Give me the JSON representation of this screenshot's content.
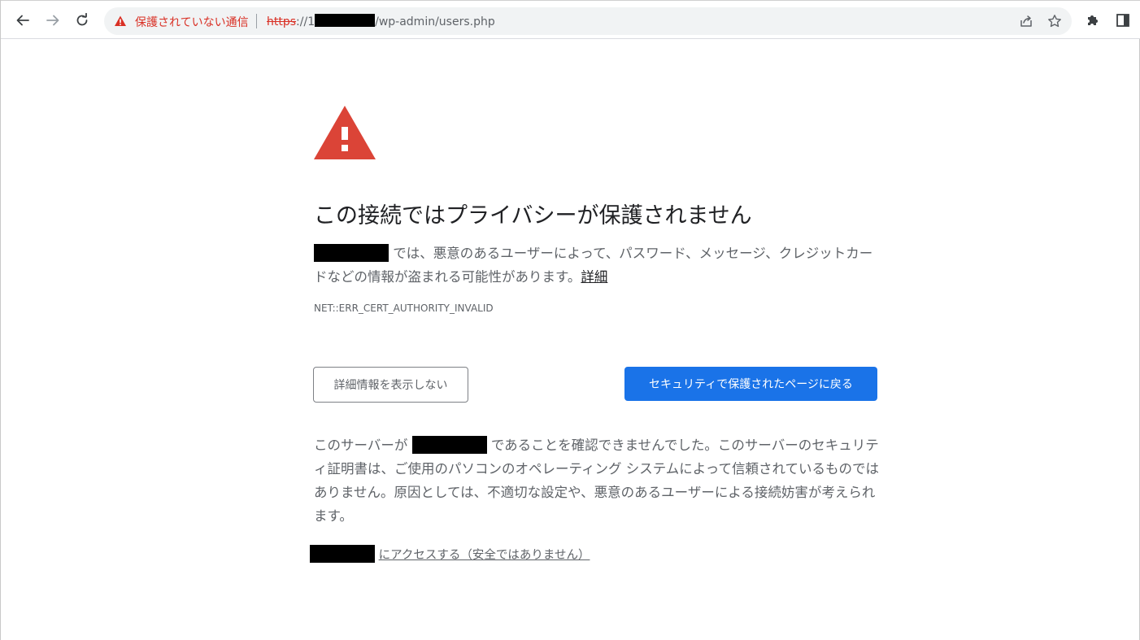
{
  "browser": {
    "omnibox": {
      "security_label": "保護されていない通信",
      "url_scheme": "https",
      "url_separator": "://1",
      "url_path": "/wp-admin/users.php"
    },
    "icons": {
      "back": "arrow-left-icon",
      "forward": "arrow-right-icon",
      "reload": "reload-icon",
      "warning": "warning-triangle-icon",
      "share": "share-icon",
      "bookmark": "star-icon",
      "extensions": "puzzle-icon",
      "side_panel": "side-panel-icon"
    }
  },
  "interstitial": {
    "heading": "この接続ではプライバシーが保護されません",
    "intro_text": "では、悪意のあるユーザーによって、パスワード、メッセージ、クレジットカードなどの情報が盗まれる可能性があります。",
    "intro_link": "詳細",
    "error_code": "NET::ERR_CERT_AUTHORITY_INVALID",
    "hide_details_button": "詳細情報を表示しない",
    "back_button": "セキュリティで保護されたページに戻る",
    "details_prefix": "このサーバーが",
    "details_text": "であることを確認できませんでした。このサーバーのセキュリティ証明書は、ご使用のパソコンのオペレーティング システムによって信頼されているものではありません。原因としては、不適切な設定や、悪意のあるユーザーによる接続妨害が考えられます。",
    "proceed_link": "にアクセスする（安全ではありません）"
  },
  "colors": {
    "danger": "#d93025",
    "primary_button": "#1a73e8",
    "warning_triangle": "#db4437"
  }
}
